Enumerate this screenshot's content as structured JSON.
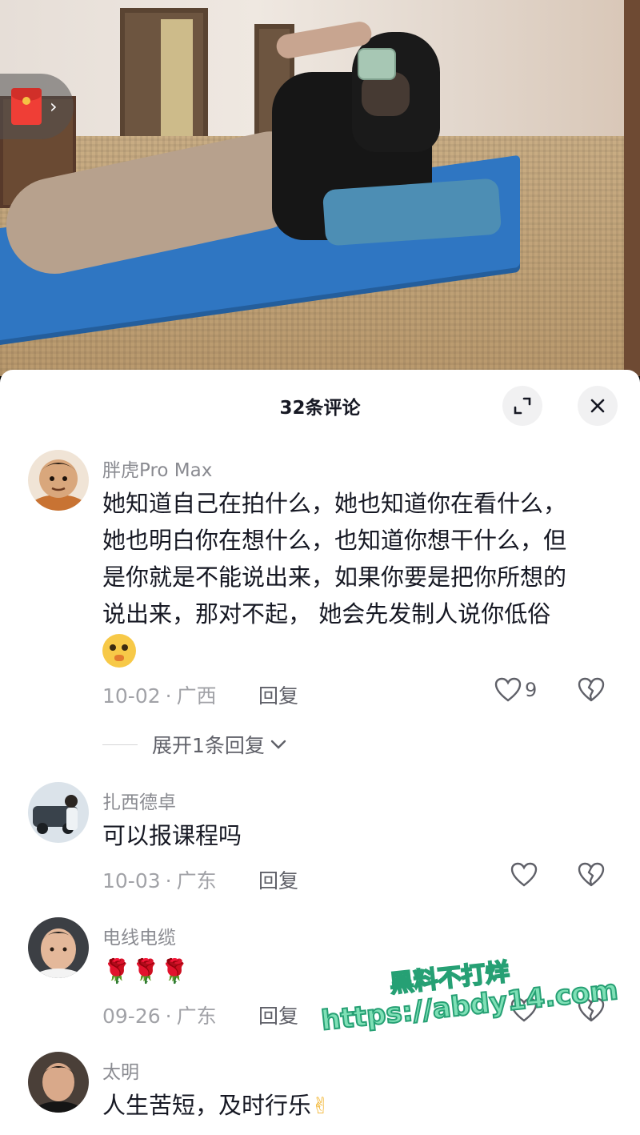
{
  "sheet": {
    "title": "32条评论"
  },
  "comments": [
    {
      "username": "胖虎Pro Max",
      "lines": [
        "她知道自己在拍什么，她也知道你在看什么，",
        "她也明白你在想什么，也知道你想干什么，但",
        "是你就是不能说出来，如果你要是把你所想的",
        "说出来，那对不起， 她会先发制人说你低俗"
      ],
      "emoji": "thinking-face-emoji",
      "date": "10-02",
      "location": "广西",
      "reply_label": "回复",
      "like_count": "9",
      "expand_replies": "展开1条回复"
    },
    {
      "username": "扎西德卓",
      "text": "可以报课程吗",
      "date": "10-03",
      "location": "广东",
      "reply_label": "回复"
    },
    {
      "username": "电线电缆",
      "text": "🌹🌹🌹",
      "date": "09-26",
      "location": "广东",
      "reply_label": "回复"
    },
    {
      "username": "太明",
      "text": "人生苦短，及时行乐",
      "emoji": "heart-hands-emoji"
    }
  ],
  "watermark": {
    "line1": "黑料不打烊",
    "line2": "https://abdy14.com"
  },
  "colors": {
    "text_primary": "#161823",
    "text_secondary": "#8a8b91",
    "watermark_fill": "#7fe0b6",
    "watermark_stroke": "#26a074",
    "red_packet": "#ef3e36"
  }
}
